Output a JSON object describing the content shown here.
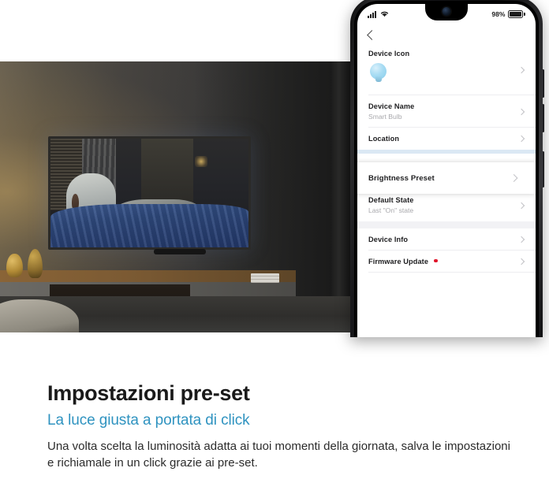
{
  "phone": {
    "status_bar": {
      "signal_icon": "cellular-signal-icon",
      "wifi_icon": "wifi-icon",
      "battery_percent": "98%"
    },
    "nav": {
      "back_icon": "back-chevron-icon"
    },
    "rows": [
      {
        "label": "Device Icon",
        "sub": "",
        "icon": "lightbulb-icon",
        "badge": false,
        "highlighted": false
      },
      {
        "label": "Device Name",
        "sub": "Smart Bulb",
        "icon": "",
        "badge": false,
        "highlighted": false
      },
      {
        "label": "Location",
        "sub": "",
        "icon": "",
        "badge": false,
        "highlighted": false
      },
      {
        "label": "Brightness Preset",
        "sub": "",
        "icon": "",
        "badge": false,
        "highlighted": true
      },
      {
        "label": "Default State",
        "sub": "Last \"On\" state",
        "icon": "",
        "badge": false,
        "highlighted": false
      },
      {
        "label": "Device Info",
        "sub": "",
        "icon": "",
        "badge": false,
        "highlighted": false
      },
      {
        "label": "Firmware Update",
        "sub": "",
        "icon": "",
        "badge": true,
        "highlighted": false
      }
    ],
    "chevron_icon": "chevron-right-icon"
  },
  "photo": {
    "alt": "living-room-at-night-with-tv-showing-family-in-bed"
  },
  "caption": {
    "title": "Impostazioni pre-set",
    "subtitle": "La luce giusta a portata di click",
    "body": "Una volta scelta la luminosità adatta ai tuoi momenti della giornata, salva le impostazioni e richiamale in un click grazie ai pre-set."
  },
  "colors": {
    "accent": "#2f93c0",
    "badge": "#e0162b",
    "bulb": "#86cdec",
    "highlight_band": "#dbe8f4"
  }
}
